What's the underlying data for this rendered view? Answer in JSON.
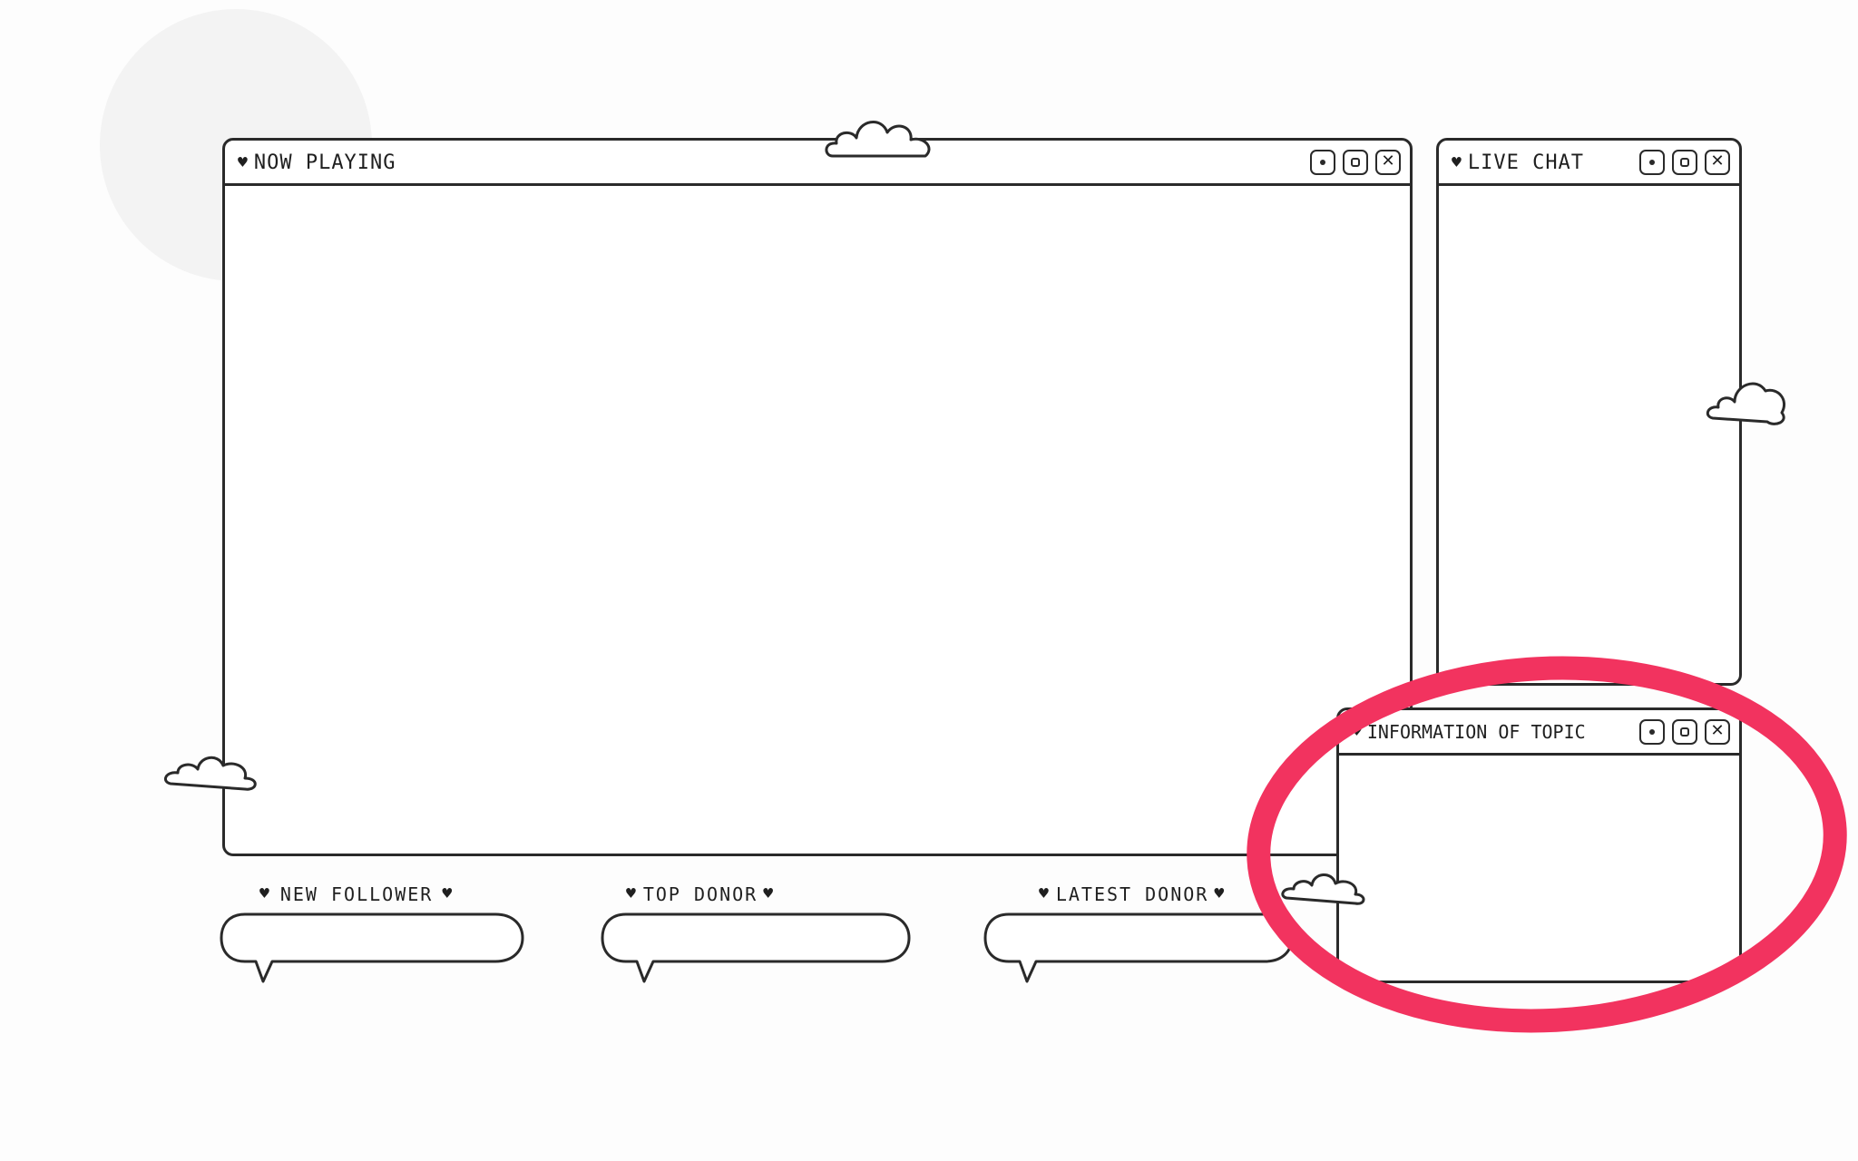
{
  "windows": {
    "now_playing": {
      "title": "NOW PLAYING"
    },
    "live_chat": {
      "title": "LIVE CHAT"
    },
    "info_topic": {
      "title": "INFORMATION OF TOPIC"
    }
  },
  "alerts": {
    "new_follower": {
      "label": "NEW FOLLOWER"
    },
    "top_donor": {
      "label": "TOP DONOR"
    },
    "latest_donor": {
      "label": "LATEST DONOR"
    }
  },
  "icons": {
    "heart": "♥",
    "close": "✕",
    "minimize": "dot-icon",
    "maximize": "square-icon",
    "decoration": "cloud-icon"
  },
  "colors": {
    "ink": "#2a2a2a",
    "paper": "#ffffff",
    "highlight": "#f2335f"
  }
}
